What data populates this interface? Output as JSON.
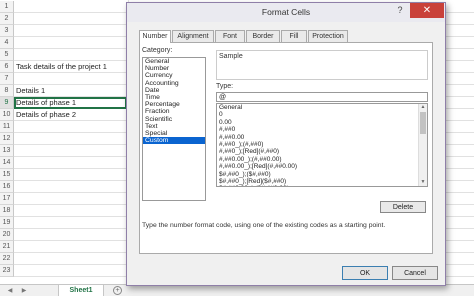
{
  "sheet": {
    "rows": [
      "1",
      "2",
      "3",
      "4",
      "5",
      "6",
      "7",
      "8",
      "9",
      "10",
      "11",
      "12",
      "13",
      "14",
      "15",
      "16",
      "17",
      "18",
      "19",
      "20",
      "21",
      "22",
      "23"
    ],
    "cells": {
      "r6": "Task details of the project 1",
      "r8": "Details 1",
      "r9": "Details of phase 1",
      "r10": "Details of phase 2"
    },
    "tab_label": "Sheet1",
    "add_sheet": "+",
    "nav_prev": "◀",
    "nav_next": "▶"
  },
  "dialog": {
    "title": "Format Cells",
    "help": "?",
    "close": "✕",
    "tabs": [
      "Number",
      "Alignment",
      "Font",
      "Border",
      "Fill",
      "Protection"
    ],
    "category_label": "Category:",
    "categories": [
      "General",
      "Number",
      "Currency",
      "Accounting",
      "Date",
      "Time",
      "Percentage",
      "Fraction",
      "Scientific",
      "Text",
      "Special",
      "Custom"
    ],
    "selected_category": "Custom",
    "sample_label": "Sample",
    "type_label": "Type:",
    "type_value": "@",
    "type_list": [
      "General",
      "0",
      "0.00",
      "#,##0",
      "#,##0.00",
      "#,##0_);(#,##0)",
      "#,##0_);[Red](#,##0)",
      "#,##0.00_);(#,##0.00)",
      "#,##0.00_);[Red](#,##0.00)",
      "$#,##0_);($#,##0)",
      "$#,##0_);[Red]($#,##0)",
      "$#,##0.00_);($#,##0.00)"
    ],
    "delete_label": "Delete",
    "hint": "Type the number format code, using one of the existing codes as a starting point.",
    "ok_label": "OK",
    "cancel_label": "Cancel"
  }
}
